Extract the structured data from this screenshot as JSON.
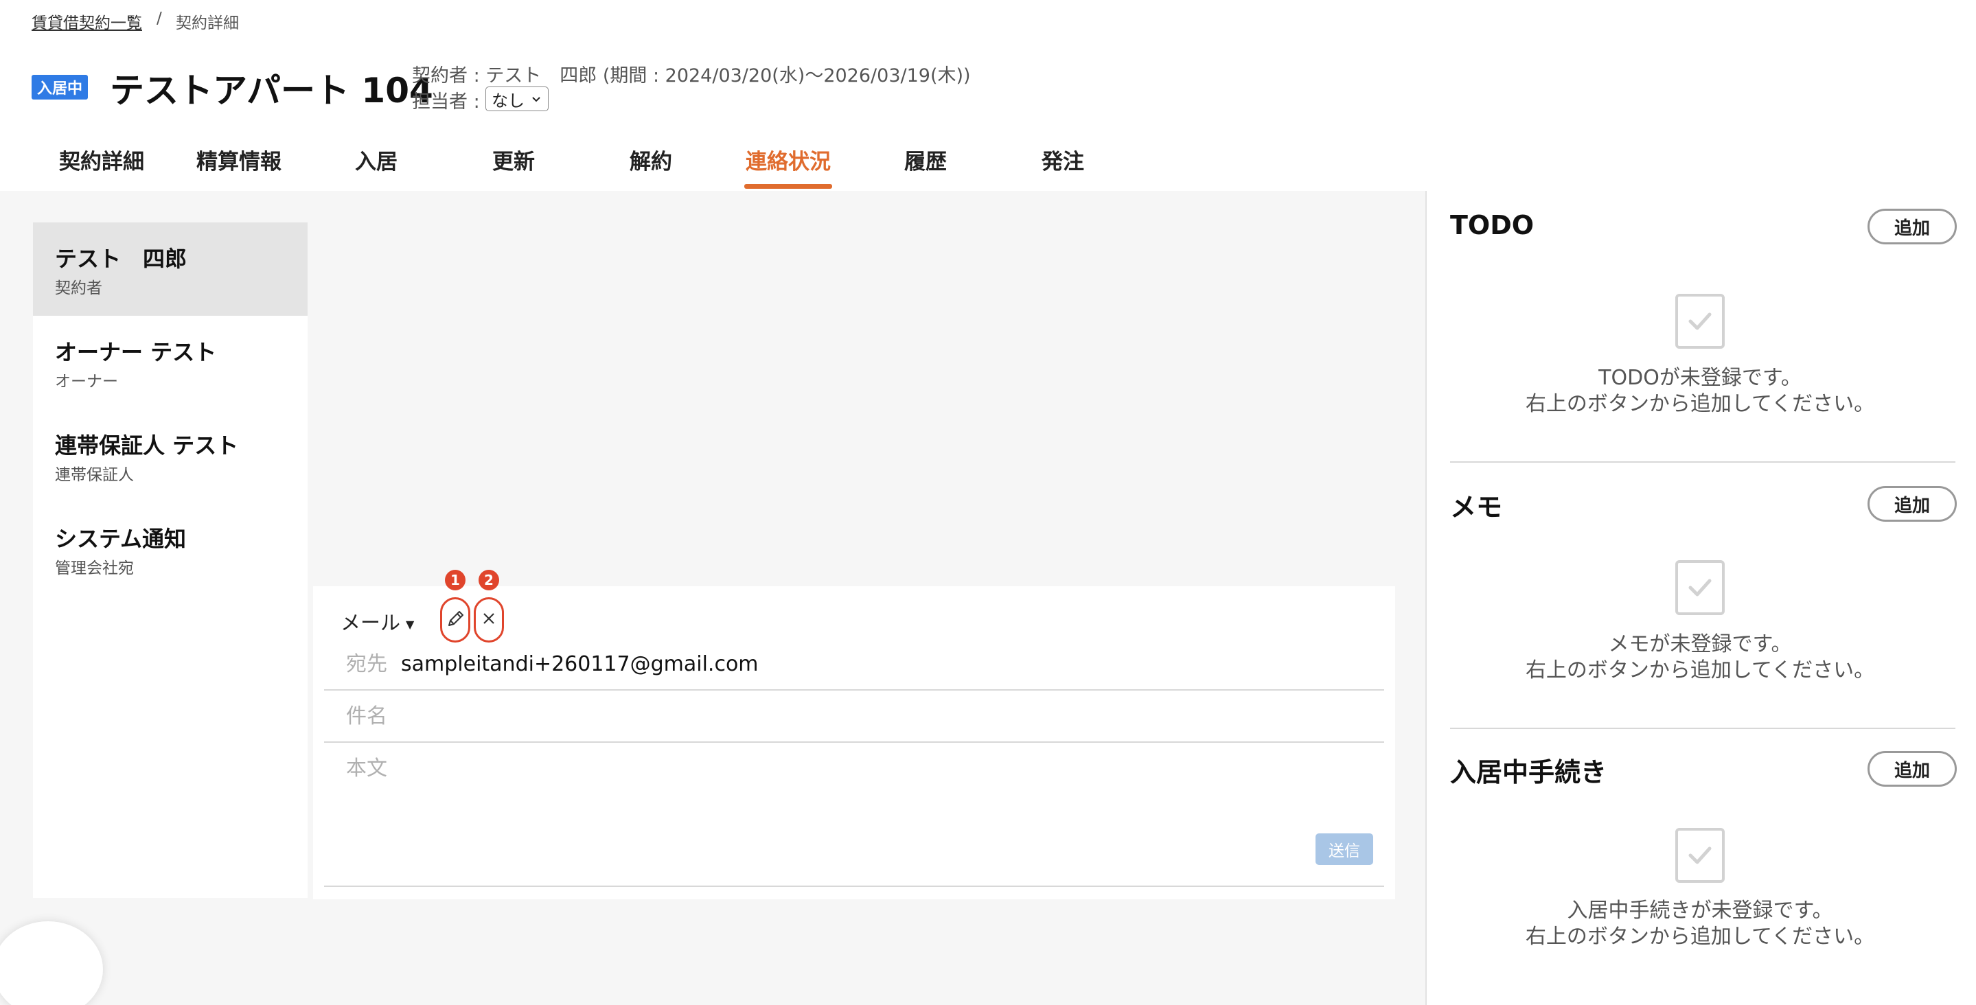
{
  "breadcrumb": {
    "parent": "賃貸借契約一覧",
    "separator": "/",
    "current": "契約詳細"
  },
  "header": {
    "status_badge": "入居中",
    "property_title": "テストアパート 104",
    "contract_info": "契約者 : テスト　四郎 (期間 : 2024/03/20(水)〜2026/03/19(木))",
    "assignee_label": "担当者 :",
    "assignee_value": "なし"
  },
  "tabs": [
    {
      "label": "契約詳細"
    },
    {
      "label": "精算情報"
    },
    {
      "label": "入居"
    },
    {
      "label": "更新"
    },
    {
      "label": "解約"
    },
    {
      "label": "連絡状況",
      "active": true
    },
    {
      "label": "履歴"
    },
    {
      "label": "発注"
    }
  ],
  "contacts": [
    {
      "name": "テスト　四郎",
      "role": "契約者",
      "selected": true
    },
    {
      "name": "オーナー テスト",
      "role": "オーナー"
    },
    {
      "name": "連帯保証人 テスト",
      "role": "連帯保証人"
    },
    {
      "name": "システム通知",
      "role": "管理会社宛"
    }
  ],
  "compose": {
    "channel": "メール",
    "edit_badge": "1",
    "close_badge": "2",
    "to_label": "宛先",
    "to_value": "sampleitandi+260117@gmail.com",
    "subject_label": "件名",
    "body_label": "本文",
    "send_label": "送信"
  },
  "side_panels": [
    {
      "title": "TODO",
      "add_label": "追加",
      "empty_line1": "TODOが未登録です。",
      "empty_line2": "右上のボタンから追加してください。"
    },
    {
      "title": "メモ",
      "add_label": "追加",
      "empty_line1": "メモが未登録です。",
      "empty_line2": "右上のボタンから追加してください。"
    },
    {
      "title": "入居中手続き",
      "add_label": "追加",
      "empty_line1": "入居中手続きが未登録です。",
      "empty_line2": "右上のボタンから追加してください。"
    }
  ],
  "colors": {
    "status_badge": "#2f7be5",
    "active_tab": "#e06c2e",
    "annotation": "#e0452c",
    "send_disabled": "#a9c6e6"
  },
  "icons": [
    "chevron-down-icon",
    "caret-down-icon",
    "pencil-icon",
    "close-icon",
    "empty-checkbox-icon"
  ]
}
